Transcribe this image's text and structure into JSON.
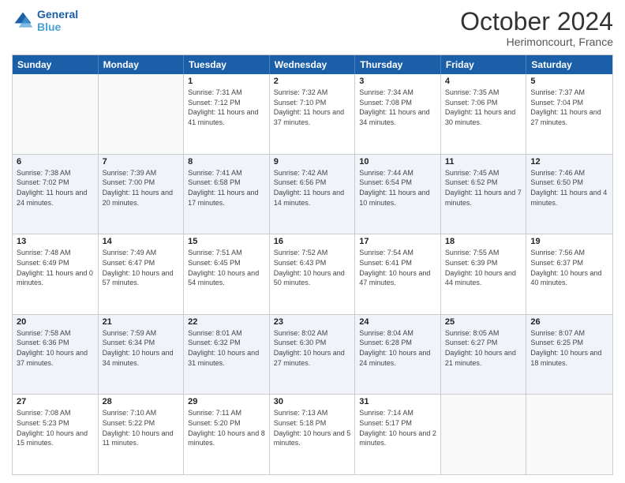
{
  "header": {
    "logo_line1": "General",
    "logo_line2": "Blue",
    "month": "October 2024",
    "location": "Herimoncourt, France"
  },
  "weekdays": [
    "Sunday",
    "Monday",
    "Tuesday",
    "Wednesday",
    "Thursday",
    "Friday",
    "Saturday"
  ],
  "rows": [
    [
      {
        "day": "",
        "info": ""
      },
      {
        "day": "",
        "info": ""
      },
      {
        "day": "1",
        "info": "Sunrise: 7:31 AM\nSunset: 7:12 PM\nDaylight: 11 hours and 41 minutes."
      },
      {
        "day": "2",
        "info": "Sunrise: 7:32 AM\nSunset: 7:10 PM\nDaylight: 11 hours and 37 minutes."
      },
      {
        "day": "3",
        "info": "Sunrise: 7:34 AM\nSunset: 7:08 PM\nDaylight: 11 hours and 34 minutes."
      },
      {
        "day": "4",
        "info": "Sunrise: 7:35 AM\nSunset: 7:06 PM\nDaylight: 11 hours and 30 minutes."
      },
      {
        "day": "5",
        "info": "Sunrise: 7:37 AM\nSunset: 7:04 PM\nDaylight: 11 hours and 27 minutes."
      }
    ],
    [
      {
        "day": "6",
        "info": "Sunrise: 7:38 AM\nSunset: 7:02 PM\nDaylight: 11 hours and 24 minutes."
      },
      {
        "day": "7",
        "info": "Sunrise: 7:39 AM\nSunset: 7:00 PM\nDaylight: 11 hours and 20 minutes."
      },
      {
        "day": "8",
        "info": "Sunrise: 7:41 AM\nSunset: 6:58 PM\nDaylight: 11 hours and 17 minutes."
      },
      {
        "day": "9",
        "info": "Sunrise: 7:42 AM\nSunset: 6:56 PM\nDaylight: 11 hours and 14 minutes."
      },
      {
        "day": "10",
        "info": "Sunrise: 7:44 AM\nSunset: 6:54 PM\nDaylight: 11 hours and 10 minutes."
      },
      {
        "day": "11",
        "info": "Sunrise: 7:45 AM\nSunset: 6:52 PM\nDaylight: 11 hours and 7 minutes."
      },
      {
        "day": "12",
        "info": "Sunrise: 7:46 AM\nSunset: 6:50 PM\nDaylight: 11 hours and 4 minutes."
      }
    ],
    [
      {
        "day": "13",
        "info": "Sunrise: 7:48 AM\nSunset: 6:49 PM\nDaylight: 11 hours and 0 minutes."
      },
      {
        "day": "14",
        "info": "Sunrise: 7:49 AM\nSunset: 6:47 PM\nDaylight: 10 hours and 57 minutes."
      },
      {
        "day": "15",
        "info": "Sunrise: 7:51 AM\nSunset: 6:45 PM\nDaylight: 10 hours and 54 minutes."
      },
      {
        "day": "16",
        "info": "Sunrise: 7:52 AM\nSunset: 6:43 PM\nDaylight: 10 hours and 50 minutes."
      },
      {
        "day": "17",
        "info": "Sunrise: 7:54 AM\nSunset: 6:41 PM\nDaylight: 10 hours and 47 minutes."
      },
      {
        "day": "18",
        "info": "Sunrise: 7:55 AM\nSunset: 6:39 PM\nDaylight: 10 hours and 44 minutes."
      },
      {
        "day": "19",
        "info": "Sunrise: 7:56 AM\nSunset: 6:37 PM\nDaylight: 10 hours and 40 minutes."
      }
    ],
    [
      {
        "day": "20",
        "info": "Sunrise: 7:58 AM\nSunset: 6:36 PM\nDaylight: 10 hours and 37 minutes."
      },
      {
        "day": "21",
        "info": "Sunrise: 7:59 AM\nSunset: 6:34 PM\nDaylight: 10 hours and 34 minutes."
      },
      {
        "day": "22",
        "info": "Sunrise: 8:01 AM\nSunset: 6:32 PM\nDaylight: 10 hours and 31 minutes."
      },
      {
        "day": "23",
        "info": "Sunrise: 8:02 AM\nSunset: 6:30 PM\nDaylight: 10 hours and 27 minutes."
      },
      {
        "day": "24",
        "info": "Sunrise: 8:04 AM\nSunset: 6:28 PM\nDaylight: 10 hours and 24 minutes."
      },
      {
        "day": "25",
        "info": "Sunrise: 8:05 AM\nSunset: 6:27 PM\nDaylight: 10 hours and 21 minutes."
      },
      {
        "day": "26",
        "info": "Sunrise: 8:07 AM\nSunset: 6:25 PM\nDaylight: 10 hours and 18 minutes."
      }
    ],
    [
      {
        "day": "27",
        "info": "Sunrise: 7:08 AM\nSunset: 5:23 PM\nDaylight: 10 hours and 15 minutes."
      },
      {
        "day": "28",
        "info": "Sunrise: 7:10 AM\nSunset: 5:22 PM\nDaylight: 10 hours and 11 minutes."
      },
      {
        "day": "29",
        "info": "Sunrise: 7:11 AM\nSunset: 5:20 PM\nDaylight: 10 hours and 8 minutes."
      },
      {
        "day": "30",
        "info": "Sunrise: 7:13 AM\nSunset: 5:18 PM\nDaylight: 10 hours and 5 minutes."
      },
      {
        "day": "31",
        "info": "Sunrise: 7:14 AM\nSunset: 5:17 PM\nDaylight: 10 hours and 2 minutes."
      },
      {
        "day": "",
        "info": ""
      },
      {
        "day": "",
        "info": ""
      }
    ]
  ]
}
